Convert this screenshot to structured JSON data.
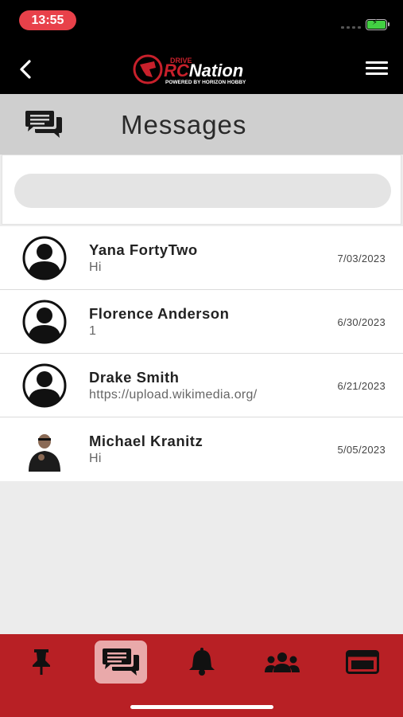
{
  "status_bar": {
    "time": "13:55"
  },
  "header": {
    "logo_text_top": "DRIVE",
    "logo_text_main": "RCNation",
    "logo_text_sub": "POWERED BY HORIZON HOBBY"
  },
  "page": {
    "title": "Messages"
  },
  "search": {
    "placeholder": ""
  },
  "conversations": [
    {
      "name": "Yana FortyTwo",
      "preview": "Hi",
      "date": "7/03/2023",
      "avatar": "default-avatar"
    },
    {
      "name": "Florence Anderson",
      "preview": "1",
      "date": "6/30/2023",
      "avatar": "default-avatar"
    },
    {
      "name": "Drake Smith",
      "preview": "https://upload.wikimedia.org/",
      "date": "6/21/2023",
      "avatar": "default-avatar"
    },
    {
      "name": "Michael Kranitz",
      "preview": "Hi",
      "date": "5/05/2023",
      "avatar": "photo-avatar"
    }
  ],
  "tabs": [
    {
      "icon": "pin-icon",
      "active": false
    },
    {
      "icon": "messages-icon",
      "active": true
    },
    {
      "icon": "bell-icon",
      "active": false
    },
    {
      "icon": "group-icon",
      "active": false
    },
    {
      "icon": "browser-icon",
      "active": false
    }
  ],
  "colors": {
    "accent": "#b82025",
    "topbar": "#000000",
    "time_pill": "#e8414a"
  }
}
